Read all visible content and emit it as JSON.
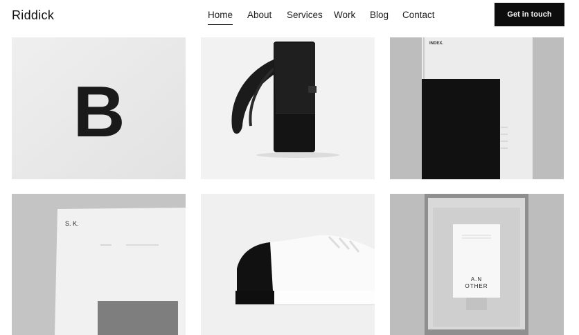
{
  "header": {
    "brand": "Riddick",
    "nav": [
      {
        "label": "Home",
        "active": true
      },
      {
        "label": "About",
        "active": false
      },
      {
        "label": "Services",
        "active": false
      },
      {
        "label": "Work",
        "active": false
      },
      {
        "label": "Blog",
        "active": false
      },
      {
        "label": "Contact",
        "active": false
      }
    ],
    "cta_label": "Get in touch"
  },
  "portfolio": {
    "tiles": [
      {
        "subject": "letter-b-print",
        "text": "B"
      },
      {
        "subject": "black-backpack"
      },
      {
        "subject": "index-booklet",
        "text": "INDEX."
      },
      {
        "subject": "sk-letterhead",
        "text": "S.   K."
      },
      {
        "subject": "black-white-sneaker"
      },
      {
        "subject": "an-other-box",
        "text_line1": "A.N",
        "text_line2": "OTHER"
      }
    ]
  },
  "colors": {
    "accent": "#0d0d0d",
    "tile_light": "#e9e9e9",
    "tile_mid": "#c8c8c8",
    "tile_dark": "#111111"
  }
}
